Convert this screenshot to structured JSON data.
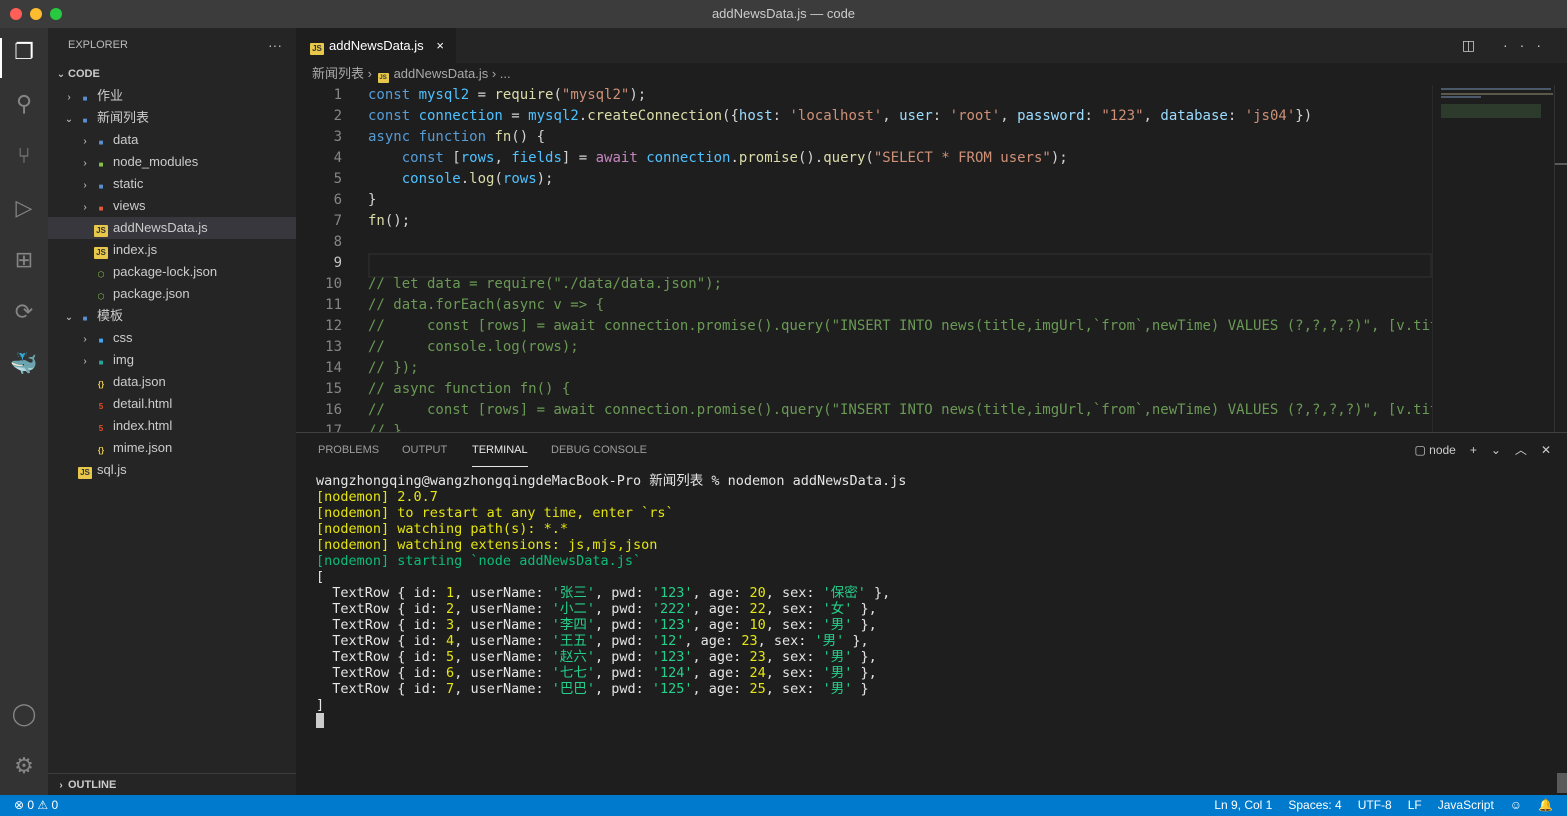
{
  "window": {
    "title": "addNewsData.js — code"
  },
  "colors": {
    "accent": "#007acc",
    "editor_bg": "#1e1e1e",
    "sidebar_bg": "#252526",
    "activity_bg": "#333333"
  },
  "activity_bar": [
    "explorer-icon",
    "search-icon",
    "source-control-icon",
    "run-debug-icon",
    "extensions-icon",
    "remote-icon",
    "docker-icon",
    "account-icon",
    "settings-gear-icon"
  ],
  "sidebar": {
    "header": "EXPLORER",
    "more": "···",
    "section": "CODE",
    "outline": "OUTLINE",
    "items": [
      {
        "label": "作业",
        "type": "folder",
        "depth": 1,
        "open": false
      },
      {
        "label": "新闻列表",
        "type": "folder",
        "depth": 1,
        "open": true
      },
      {
        "label": "data",
        "type": "folder",
        "depth": 2,
        "open": false
      },
      {
        "label": "node_modules",
        "type": "folder-node",
        "depth": 2,
        "open": false
      },
      {
        "label": "static",
        "type": "folder",
        "depth": 2,
        "open": false
      },
      {
        "label": "views",
        "type": "folder-views",
        "depth": 2,
        "open": false
      },
      {
        "label": "addNewsData.js",
        "type": "js",
        "depth": 2,
        "selected": true
      },
      {
        "label": "index.js",
        "type": "js",
        "depth": 2
      },
      {
        "label": "package-lock.json",
        "type": "npm",
        "depth": 2
      },
      {
        "label": "package.json",
        "type": "npm",
        "depth": 2
      },
      {
        "label": "模板",
        "type": "folder",
        "depth": 1,
        "open": true
      },
      {
        "label": "css",
        "type": "folder-css",
        "depth": 2,
        "open": false
      },
      {
        "label": "img",
        "type": "folder-img",
        "depth": 2,
        "open": false
      },
      {
        "label": "data.json",
        "type": "json",
        "depth": 2
      },
      {
        "label": "detail.html",
        "type": "html",
        "depth": 2
      },
      {
        "label": "index.html",
        "type": "html",
        "depth": 2
      },
      {
        "label": "mime.json",
        "type": "json",
        "depth": 2
      },
      {
        "label": "sql.js",
        "type": "js",
        "depth": 1
      }
    ]
  },
  "editor": {
    "tab": {
      "label": "addNewsData.js",
      "close": "×"
    },
    "tab_actions": "◫ ···",
    "breadcrumb": [
      "新闻列表",
      "addNewsData.js",
      "..."
    ],
    "current_line": 9,
    "lines": [
      [
        [
          "kw",
          "const "
        ],
        [
          "var",
          "mysql2"
        ],
        [
          "pun",
          " = "
        ],
        [
          "fn",
          "require"
        ],
        [
          "pun",
          "("
        ],
        [
          "str",
          "\"mysql2\""
        ],
        [
          "pun",
          ");"
        ]
      ],
      [
        [
          "kw",
          "const "
        ],
        [
          "var",
          "connection"
        ],
        [
          "pun",
          " = "
        ],
        [
          "var",
          "mysql2"
        ],
        [
          "pun",
          "."
        ],
        [
          "fn",
          "createConnection"
        ],
        [
          "pun",
          "({"
        ],
        [
          "prop",
          "host"
        ],
        [
          "pun",
          ": "
        ],
        [
          "str",
          "'localhost'"
        ],
        [
          "pun",
          ", "
        ],
        [
          "prop",
          "user"
        ],
        [
          "pun",
          ": "
        ],
        [
          "str",
          "'root'"
        ],
        [
          "pun",
          ", "
        ],
        [
          "prop",
          "password"
        ],
        [
          "pun",
          ": "
        ],
        [
          "str",
          "\"123\""
        ],
        [
          "pun",
          ", "
        ],
        [
          "prop",
          "database"
        ],
        [
          "pun",
          ": "
        ],
        [
          "str",
          "'js04'"
        ],
        [
          "pun",
          "})"
        ]
      ],
      [
        [
          "kw",
          "async function "
        ],
        [
          "fn",
          "fn"
        ],
        [
          "pun",
          "() {"
        ]
      ],
      [
        [
          "pun",
          "    "
        ],
        [
          "kw",
          "const "
        ],
        [
          "pun",
          "["
        ],
        [
          "var",
          "rows"
        ],
        [
          "pun",
          ", "
        ],
        [
          "var",
          "fields"
        ],
        [
          "pun",
          "] = "
        ],
        [
          "aw",
          "await "
        ],
        [
          "var",
          "connection"
        ],
        [
          "pun",
          "."
        ],
        [
          "fn",
          "promise"
        ],
        [
          "pun",
          "()."
        ],
        [
          "fn",
          "query"
        ],
        [
          "pun",
          "("
        ],
        [
          "str",
          "\"SELECT * FROM users\""
        ],
        [
          "pun",
          ");"
        ]
      ],
      [
        [
          "pun",
          "    "
        ],
        [
          "var",
          "console"
        ],
        [
          "pun",
          "."
        ],
        [
          "fn",
          "log"
        ],
        [
          "pun",
          "("
        ],
        [
          "var",
          "rows"
        ],
        [
          "pun",
          ");"
        ]
      ],
      [
        [
          "pun",
          "}"
        ]
      ],
      [
        [
          "fn",
          "fn"
        ],
        [
          "pun",
          "();"
        ]
      ],
      [],
      [],
      [
        [
          "cm",
          "// let data = require(\"./data/data.json\");"
        ]
      ],
      [
        [
          "cm",
          "// data.forEach(async v => {"
        ]
      ],
      [
        [
          "cm",
          "//     const [rows] = await connection.promise().query(\"INSERT INTO news(title,imgUrl,`from`,newTime) VALUES (?,?,?,?)\", [v.title"
        ]
      ],
      [
        [
          "cm",
          "//     console.log(rows);"
        ]
      ],
      [
        [
          "cm",
          "// });"
        ]
      ],
      [
        [
          "cm",
          "// async function fn() {"
        ]
      ],
      [
        [
          "cm",
          "//     const [rows] = await connection.promise().query(\"INSERT INTO news(title,imgUrl,`from`,newTime) VALUES (?,?,?,?)\", [v.title"
        ]
      ],
      [
        [
          "cm",
          "// }"
        ]
      ]
    ]
  },
  "panel": {
    "tabs": [
      "PROBLEMS",
      "OUTPUT",
      "TERMINAL",
      "DEBUG CONSOLE"
    ],
    "active_tab": "TERMINAL",
    "terminal_name": "node",
    "actions": [
      "+",
      "⌄",
      "︿",
      "✕"
    ],
    "lines": [
      [
        [
          "t-w",
          "wangzhongqing@wangzhongqingdeMacBook-Pro 新闻列表 % nodemon addNewsData.js"
        ]
      ],
      [
        [
          "t-y",
          "[nodemon] 2.0.7"
        ]
      ],
      [
        [
          "t-y",
          "[nodemon] to restart at any time, enter `rs`"
        ]
      ],
      [
        [
          "t-y",
          "[nodemon] watching path(s): *.*"
        ]
      ],
      [
        [
          "t-y",
          "[nodemon] watching extensions: js,mjs,json"
        ]
      ],
      [
        [
          "t-gs",
          "[nodemon] starting `node addNewsData.js`"
        ]
      ],
      [
        [
          "t-w",
          "["
        ]
      ],
      [
        [
          "t-w",
          "  TextRow { id: "
        ],
        [
          "t-y",
          "1"
        ],
        [
          "t-w",
          ", userName: "
        ],
        [
          "t-g",
          "'张三'"
        ],
        [
          "t-w",
          ", pwd: "
        ],
        [
          "t-g",
          "'123'"
        ],
        [
          "t-w",
          ", age: "
        ],
        [
          "t-y",
          "20"
        ],
        [
          "t-w",
          ", sex: "
        ],
        [
          "t-g",
          "'保密'"
        ],
        [
          "t-w",
          " },"
        ]
      ],
      [
        [
          "t-w",
          "  TextRow { id: "
        ],
        [
          "t-y",
          "2"
        ],
        [
          "t-w",
          ", userName: "
        ],
        [
          "t-g",
          "'小二'"
        ],
        [
          "t-w",
          ", pwd: "
        ],
        [
          "t-g",
          "'222'"
        ],
        [
          "t-w",
          ", age: "
        ],
        [
          "t-y",
          "22"
        ],
        [
          "t-w",
          ", sex: "
        ],
        [
          "t-g",
          "'女'"
        ],
        [
          "t-w",
          " },"
        ]
      ],
      [
        [
          "t-w",
          "  TextRow { id: "
        ],
        [
          "t-y",
          "3"
        ],
        [
          "t-w",
          ", userName: "
        ],
        [
          "t-g",
          "'李四'"
        ],
        [
          "t-w",
          ", pwd: "
        ],
        [
          "t-g",
          "'123'"
        ],
        [
          "t-w",
          ", age: "
        ],
        [
          "t-y",
          "10"
        ],
        [
          "t-w",
          ", sex: "
        ],
        [
          "t-g",
          "'男'"
        ],
        [
          "t-w",
          " },"
        ]
      ],
      [
        [
          "t-w",
          "  TextRow { id: "
        ],
        [
          "t-y",
          "4"
        ],
        [
          "t-w",
          ", userName: "
        ],
        [
          "t-g",
          "'王五'"
        ],
        [
          "t-w",
          ", pwd: "
        ],
        [
          "t-g",
          "'12'"
        ],
        [
          "t-w",
          ", age: "
        ],
        [
          "t-y",
          "23"
        ],
        [
          "t-w",
          ", sex: "
        ],
        [
          "t-g",
          "'男'"
        ],
        [
          "t-w",
          " },"
        ]
      ],
      [
        [
          "t-w",
          "  TextRow { id: "
        ],
        [
          "t-y",
          "5"
        ],
        [
          "t-w",
          ", userName: "
        ],
        [
          "t-g",
          "'赵六'"
        ],
        [
          "t-w",
          ", pwd: "
        ],
        [
          "t-g",
          "'123'"
        ],
        [
          "t-w",
          ", age: "
        ],
        [
          "t-y",
          "23"
        ],
        [
          "t-w",
          ", sex: "
        ],
        [
          "t-g",
          "'男'"
        ],
        [
          "t-w",
          " },"
        ]
      ],
      [
        [
          "t-w",
          "  TextRow { id: "
        ],
        [
          "t-y",
          "6"
        ],
        [
          "t-w",
          ", userName: "
        ],
        [
          "t-g",
          "'七七'"
        ],
        [
          "t-w",
          ", pwd: "
        ],
        [
          "t-g",
          "'124'"
        ],
        [
          "t-w",
          ", age: "
        ],
        [
          "t-y",
          "24"
        ],
        [
          "t-w",
          ", sex: "
        ],
        [
          "t-g",
          "'男'"
        ],
        [
          "t-w",
          " },"
        ]
      ],
      [
        [
          "t-w",
          "  TextRow { id: "
        ],
        [
          "t-y",
          "7"
        ],
        [
          "t-w",
          ", userName: "
        ],
        [
          "t-g",
          "'巴巴'"
        ],
        [
          "t-w",
          ", pwd: "
        ],
        [
          "t-g",
          "'125'"
        ],
        [
          "t-w",
          ", age: "
        ],
        [
          "t-y",
          "25"
        ],
        [
          "t-w",
          ", sex: "
        ],
        [
          "t-g",
          "'男'"
        ],
        [
          "t-w",
          " }"
        ]
      ],
      [
        [
          "t-w",
          "]"
        ]
      ]
    ]
  },
  "status": {
    "errors": "⊗ 0",
    "warnings": "⚠ 0",
    "right": [
      "Ln 9, Col 1",
      "Spaces: 4",
      "UTF-8",
      "LF",
      "JavaScript"
    ]
  }
}
